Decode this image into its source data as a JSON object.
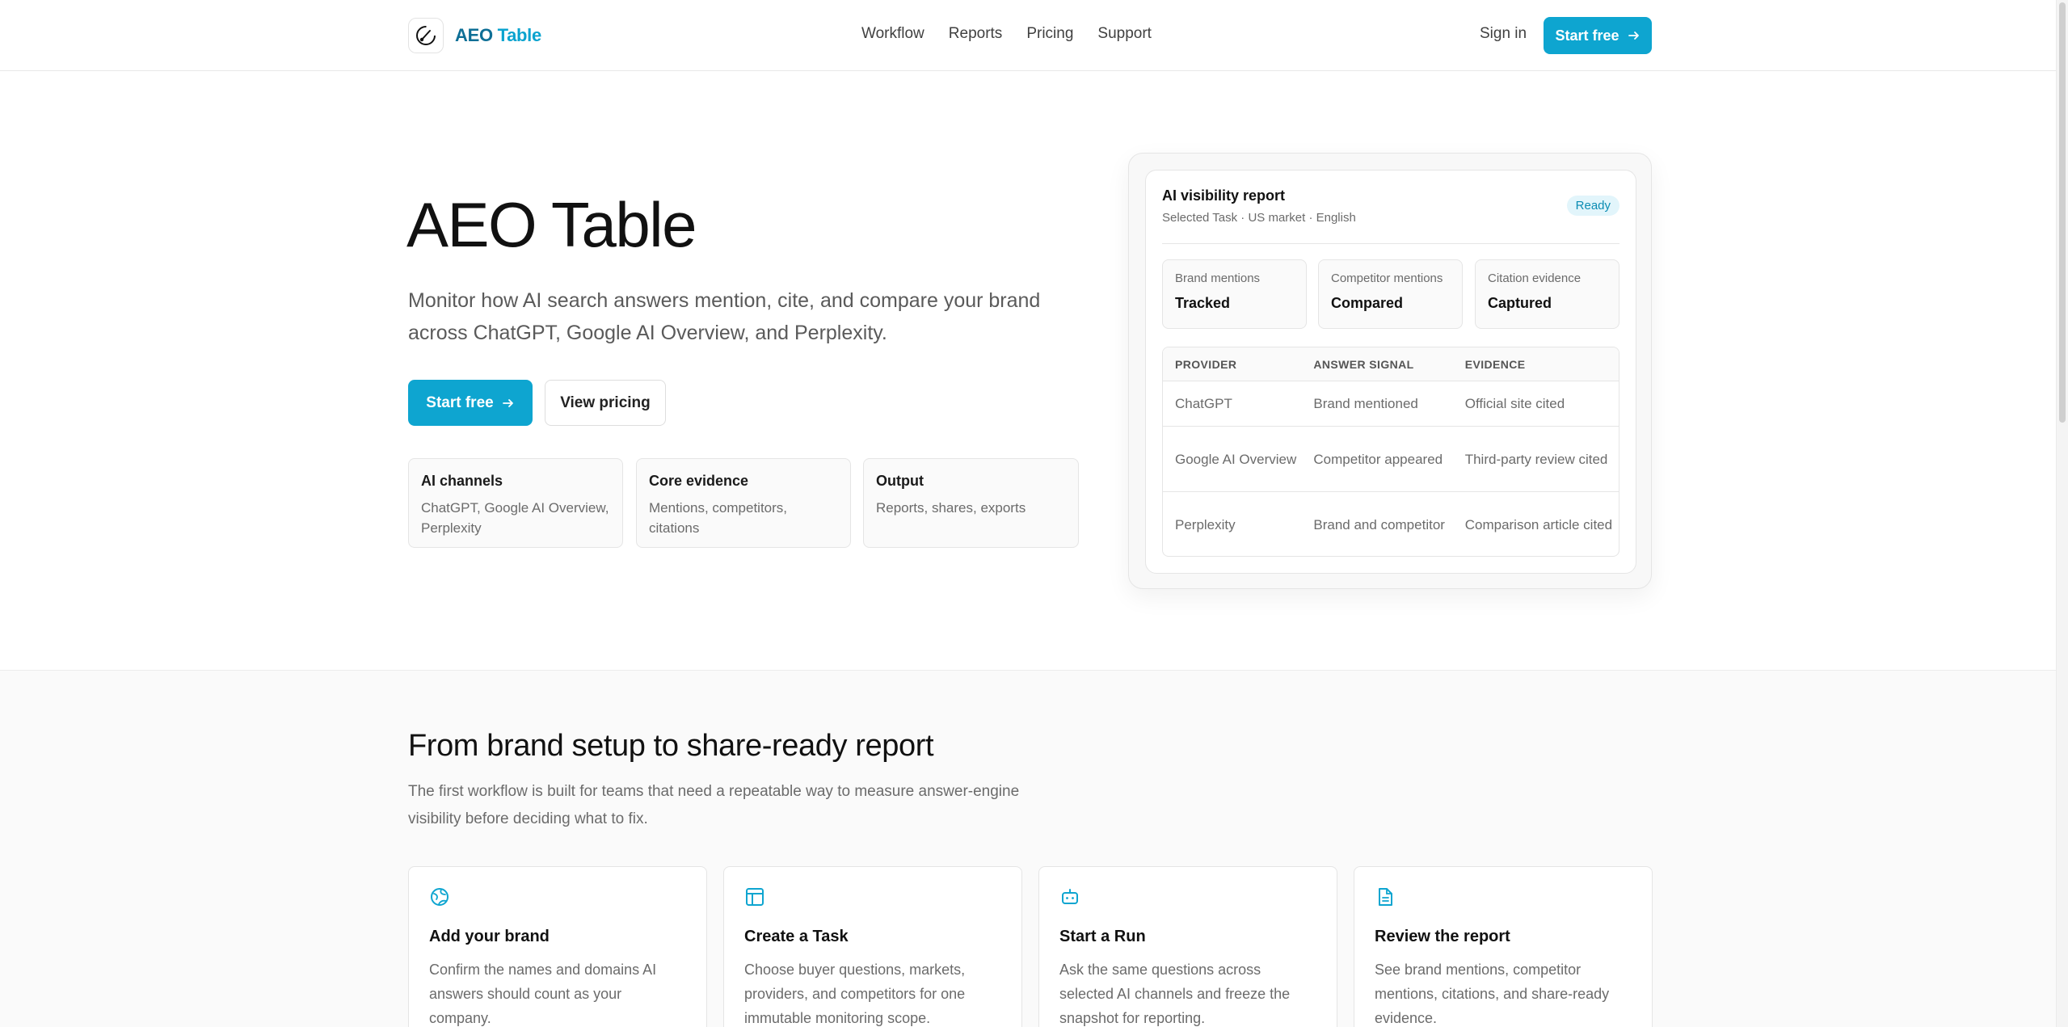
{
  "colors": {
    "accent": "#0ea5d0",
    "brand_dark": "#0e6f96",
    "badge_bg": "#e2f5fb"
  },
  "header": {
    "brand_part1": "AEO",
    "brand_part2": "Table",
    "nav": [
      "Workflow",
      "Reports",
      "Pricing",
      "Support"
    ],
    "sign_in": "Sign in",
    "cta": "Start free",
    "cta_icon": "arrow-right-icon"
  },
  "hero": {
    "title": "AEO Table",
    "subtitle": "Monitor how AI search answers mention, cite, and compare your brand across ChatGPT, Google AI Overview, and Perplexity.",
    "primary_cta": "Start free",
    "secondary_cta": "View pricing",
    "features": [
      {
        "title": "AI channels",
        "desc": "ChatGPT, Google AI Overview, Perplexity"
      },
      {
        "title": "Core evidence",
        "desc": "Mentions, competitors, citations"
      },
      {
        "title": "Output",
        "desc": "Reports, shares, exports"
      }
    ]
  },
  "report": {
    "title": "AI visibility report",
    "subtitle": "Selected Task · US market · English",
    "badge": "Ready",
    "metrics": [
      {
        "label": "Brand mentions",
        "value": "Tracked"
      },
      {
        "label": "Competitor mentions",
        "value": "Compared"
      },
      {
        "label": "Citation evidence",
        "value": "Captured"
      }
    ],
    "columns": [
      "PROVIDER",
      "ANSWER SIGNAL",
      "EVIDENCE"
    ],
    "rows": [
      [
        "ChatGPT",
        "Brand mentioned",
        "Official site cited"
      ],
      [
        "Google AI Overview",
        "Competitor appeared",
        "Third-party review cited"
      ],
      [
        "Perplexity",
        "Brand and competitor",
        "Comparison article cited"
      ]
    ]
  },
  "workflow": {
    "title": "From brand setup to share-ready report",
    "subtitle": "The first workflow is built for teams that need a repeatable way to measure answer-engine visibility before deciding what to fix.",
    "steps": [
      {
        "icon": "globe-icon",
        "title": "Add your brand",
        "desc": "Confirm the names and domains AI answers should count as your company."
      },
      {
        "icon": "layout-icon",
        "title": "Create a Task",
        "desc": "Choose buyer questions, markets, providers, and competitors for one immutable monitoring scope."
      },
      {
        "icon": "bot-icon",
        "title": "Start a Run",
        "desc": "Ask the same questions across selected AI channels and freeze the snapshot for reporting."
      },
      {
        "icon": "file-text-icon",
        "title": "Review the report",
        "desc": "See brand mentions, competitor mentions, citations, and share-ready evidence."
      }
    ]
  }
}
